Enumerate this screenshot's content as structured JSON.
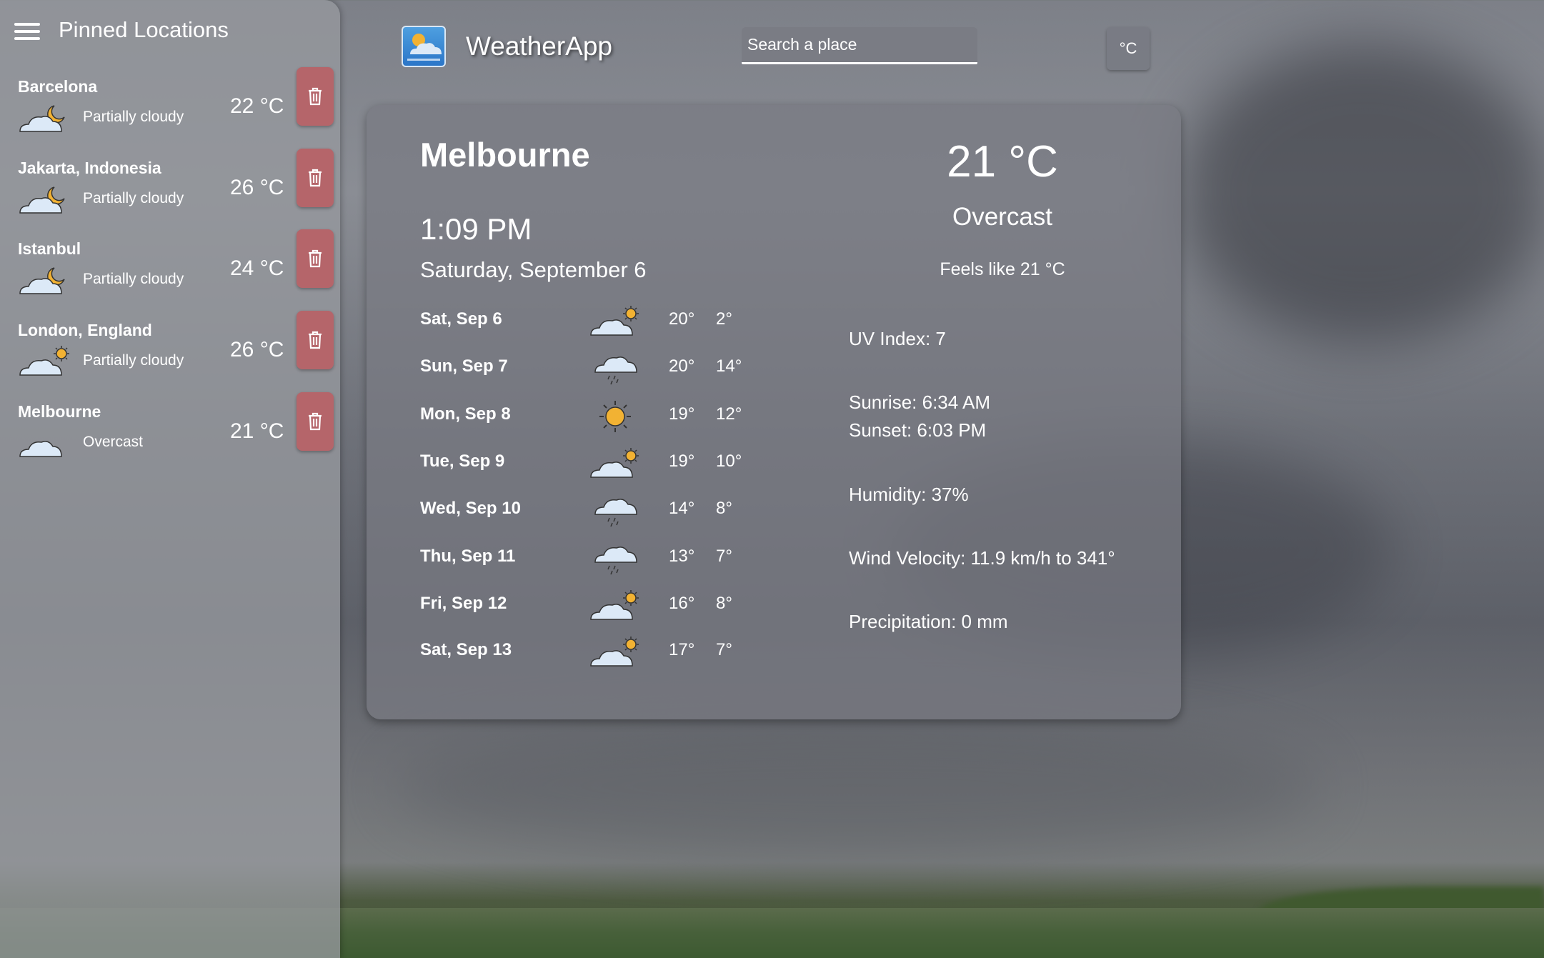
{
  "sidebar": {
    "title": "Pinned Locations",
    "items": [
      {
        "name": "Barcelona",
        "condition": "Partially cloudy",
        "temp": "22 °C",
        "icon": "cloud-moon-icon"
      },
      {
        "name": "Jakarta, Indonesia",
        "condition": "Partially cloudy",
        "temp": "26 °C",
        "icon": "cloud-moon-icon"
      },
      {
        "name": "Istanbul",
        "condition": "Partially cloudy",
        "temp": "24 °C",
        "icon": "cloud-moon-icon"
      },
      {
        "name": "London, England",
        "condition": "Partially cloudy",
        "temp": "26 °C",
        "icon": "cloud-sun-icon"
      },
      {
        "name": "Melbourne",
        "condition": "Overcast",
        "temp": "21 °C",
        "icon": "cloud-icon"
      }
    ]
  },
  "header": {
    "app_title": "WeatherApp",
    "search_placeholder": "Search a place",
    "unit_label": "°C"
  },
  "current": {
    "city": "Melbourne",
    "time": "1:09 PM",
    "date": "Saturday, September 6",
    "temp": "21 °C",
    "condition": "Overcast",
    "feels_like": "Feels like 21 °C",
    "uv": "UV Index: 7",
    "sunrise": "Sunrise: 6:34 AM",
    "sunset": "Sunset: 6:03 PM",
    "humidity": "Humidity: 37%",
    "wind": "Wind Velocity: 11.9 km/h to 341°",
    "precipitation": "Precipitation: 0 mm"
  },
  "forecast": [
    {
      "day": "Sat, Sep 6",
      "hi": "20°",
      "lo": "2°",
      "icon": "cloud-sun-icon"
    },
    {
      "day": "Sun, Sep 7",
      "hi": "20°",
      "lo": "14°",
      "icon": "rain-cloud-icon"
    },
    {
      "day": "Mon, Sep 8",
      "hi": "19°",
      "lo": "12°",
      "icon": "sun-icon"
    },
    {
      "day": "Tue, Sep 9",
      "hi": "19°",
      "lo": "10°",
      "icon": "cloud-sun-icon"
    },
    {
      "day": "Wed, Sep 10",
      "hi": "14°",
      "lo": "8°",
      "icon": "rain-cloud-icon"
    },
    {
      "day": "Thu, Sep 11",
      "hi": "13°",
      "lo": "7°",
      "icon": "rain-cloud-icon"
    },
    {
      "day": "Fri, Sep 12",
      "hi": "16°",
      "lo": "8°",
      "icon": "cloud-sun-icon"
    },
    {
      "day": "Sat, Sep 13",
      "hi": "17°",
      "lo": "7°",
      "icon": "cloud-sun-icon"
    }
  ],
  "colors": {
    "delete_button": "#b5656a",
    "sun": "#f2b233",
    "cloud": "#dce9f7"
  }
}
